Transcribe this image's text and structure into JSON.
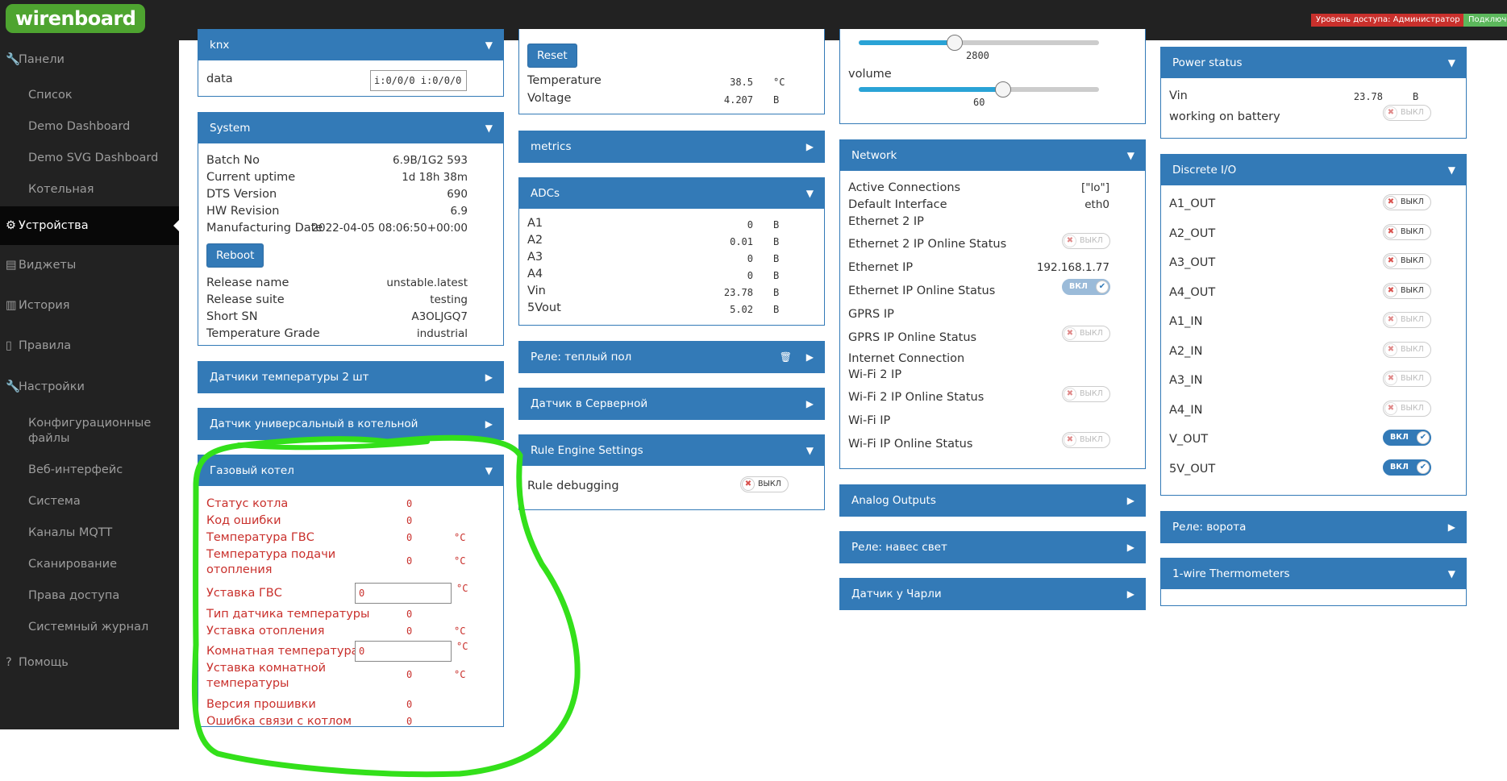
{
  "topbar": {
    "logo": "wirenboard",
    "access_badge": "Уровень доступа: Администратор",
    "conn_badge": "Подключено"
  },
  "sidebar": {
    "items": [
      {
        "label": "Панели",
        "icon": "wrench-icon"
      },
      {
        "label": "Список"
      },
      {
        "label": "Demo Dashboard"
      },
      {
        "label": "Demo SVG Dashboard"
      },
      {
        "label": "Котельная"
      },
      {
        "label": "Устройства",
        "icon": "gear-icon"
      },
      {
        "label": "Виджеты",
        "icon": "list-icon"
      },
      {
        "label": "История",
        "icon": "chart-icon"
      },
      {
        "label": "Правила",
        "icon": "file-icon"
      },
      {
        "label": "Настройки",
        "icon": "wrench-icon"
      },
      {
        "label": "Конфигурационные"
      },
      {
        "label": "файлы"
      },
      {
        "label": "Веб-интерфейс"
      },
      {
        "label": "Система"
      },
      {
        "label": "Каналы MQTT"
      },
      {
        "label": "Сканирование"
      },
      {
        "label": "Права доступа"
      },
      {
        "label": "Системный журнал"
      },
      {
        "label": "Помощь",
        "icon": "question-icon"
      }
    ]
  },
  "knx": {
    "title": "knx",
    "data_label": "data",
    "data_value": "i:0/0/0 i:0/0/0"
  },
  "system": {
    "title": "System",
    "rows": [
      {
        "label": "Batch No",
        "value": "6.9B/1G2 593"
      },
      {
        "label": "Current uptime",
        "value": "1d 18h 38m"
      },
      {
        "label": "DTS Version",
        "value": "690"
      },
      {
        "label": "HW Revision",
        "value": "6.9"
      },
      {
        "label": "Manufacturing Date",
        "value": "2022-04-05 08:06:50+00:00"
      }
    ],
    "reboot": "Reboot",
    "rows2": [
      {
        "label": "Release name",
        "value": "unstable.latest"
      },
      {
        "label": "Release suite",
        "value": "testing"
      },
      {
        "label": "Short SN",
        "value": "A3OLJGQ7"
      },
      {
        "label": "Temperature Grade",
        "value": "industrial"
      }
    ]
  },
  "temp_sensors": {
    "title": "Датчики температуры 2 шт"
  },
  "universal_sensor": {
    "title": "Датчик универсальный в котельной"
  },
  "boiler": {
    "title": "Газовый котел",
    "rows": [
      {
        "label": "Статус котла",
        "value": "0",
        "unit": ""
      },
      {
        "label": "Код ошибки",
        "value": "0",
        "unit": ""
      },
      {
        "label": "Температура ГВС",
        "value": "0",
        "unit": "°C"
      },
      {
        "label": "Температура подачи",
        "label2": "отопления",
        "value": "0",
        "unit": "°C"
      },
      {
        "label": "Уставка ГВС",
        "value": "0",
        "unit": "°C"
      },
      {
        "label": "Тип датчика температуры",
        "value": "0",
        "unit": ""
      },
      {
        "label": "Уставка отопления",
        "value": "0",
        "unit": "°C"
      },
      {
        "label": "Комнатная температура",
        "value": "0",
        "unit": "°C"
      },
      {
        "label": "Уставка комнатной",
        "label2": "температуры",
        "value": "0",
        "unit": "°C"
      },
      {
        "label": "Версия прошивки",
        "value": "0",
        "unit": ""
      },
      {
        "label": "Ошибка связи с котлом",
        "value": "0",
        "unit": ""
      }
    ]
  },
  "battery": {
    "reset": "Reset",
    "rows": [
      {
        "label": "Temperature",
        "value": "38.5",
        "unit": "°C"
      },
      {
        "label": "Voltage",
        "value": "4.207",
        "unit": "В"
      }
    ]
  },
  "metrics": {
    "title": "metrics"
  },
  "adcs": {
    "title": "ADCs",
    "rows": [
      {
        "label": "A1",
        "value": "0",
        "unit": "В"
      },
      {
        "label": "A2",
        "value": "0.01",
        "unit": "В"
      },
      {
        "label": "A3",
        "value": "0",
        "unit": "В"
      },
      {
        "label": "A4",
        "value": "0",
        "unit": "В"
      },
      {
        "label": "Vin",
        "value": "23.78",
        "unit": "В"
      },
      {
        "label": "5Vout",
        "value": "5.02",
        "unit": "В"
      }
    ]
  },
  "relay_floor": {
    "title": "Реле: теплый пол"
  },
  "server_sensor": {
    "title": "Датчик в Серверной"
  },
  "rule_engine": {
    "title": "Rule Engine Settings",
    "debug_label": "Rule debugging",
    "debug_state": "ВЫКЛ"
  },
  "media": {
    "slider1_value": "2800",
    "slider1_fraction": 0.4,
    "volume_label": "volume",
    "volume_value": "60",
    "volume_fraction": 0.6
  },
  "network": {
    "title": "Network",
    "active_connections_label": "Active Connections",
    "active_connections_value": "[\"lo\"]",
    "default_interface_label": "Default Interface",
    "default_interface_value": "eth0",
    "eth2_ip_label": "Ethernet 2 IP",
    "eth2_status_label": "Ethernet 2 IP Online Status",
    "eth2_status": "ВЫКЛ",
    "eth_ip_label": "Ethernet IP",
    "eth_ip_value": "192.168.1.77",
    "eth_status_label": "Ethernet IP Online Status",
    "eth_status": "ВКЛ",
    "gprs_ip_label": "GPRS IP",
    "gprs_status_label": "GPRS IP Online Status",
    "gprs_status": "ВЫКЛ",
    "internet_label": "Internet Connection",
    "wifi2_ip_label": "Wi-Fi 2 IP",
    "wifi2_status_label": "Wi-Fi 2 IP Online Status",
    "wifi2_status": "ВЫКЛ",
    "wifi_ip_label": "Wi-Fi IP",
    "wifi_status_label": "Wi-Fi IP Online Status",
    "wifi_status": "ВЫКЛ"
  },
  "analog_outputs": {
    "title": "Analog Outputs"
  },
  "relay_light": {
    "title": "Реле: навес свет"
  },
  "charlie_sensor": {
    "title": "Датчик у Чарли"
  },
  "power_status": {
    "title": "Power status",
    "vin_label": "Vin",
    "vin_value": "23.78",
    "vin_unit": "В",
    "battery_label": "working on battery",
    "battery_state": "ВЫКЛ"
  },
  "discrete_io": {
    "title": "Discrete I/O",
    "rows": [
      {
        "label": "A1_OUT",
        "state": "ВЫКЛ"
      },
      {
        "label": "A2_OUT",
        "state": "ВЫКЛ"
      },
      {
        "label": "A3_OUT",
        "state": "ВЫКЛ"
      },
      {
        "label": "A4_OUT",
        "state": "ВЫКЛ"
      },
      {
        "label": "A1_IN",
        "state": "ВЫКЛ"
      },
      {
        "label": "A2_IN",
        "state": "ВЫКЛ"
      },
      {
        "label": "A3_IN",
        "state": "ВЫКЛ"
      },
      {
        "label": "A4_IN",
        "state": "ВЫКЛ"
      },
      {
        "label": "V_OUT",
        "state": "ВКЛ"
      },
      {
        "label": "5V_OUT",
        "state": "ВКЛ"
      }
    ]
  },
  "relay_gate": {
    "title": "Реле: ворота"
  },
  "onewire": {
    "title": "1-wire Thermometers"
  },
  "colors": {
    "accent": "#337ab7",
    "sidebar": "#222222",
    "alarm": "#c9302c",
    "annotation": "#33e01a"
  }
}
